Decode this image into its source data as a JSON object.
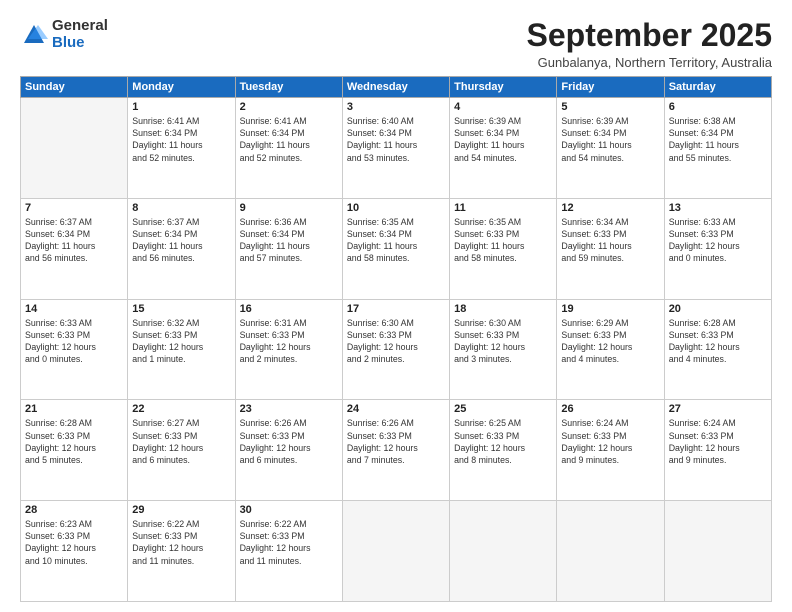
{
  "logo": {
    "general": "General",
    "blue": "Blue"
  },
  "title": "September 2025",
  "subtitle": "Gunbalanya, Northern Territory, Australia",
  "days_header": [
    "Sunday",
    "Monday",
    "Tuesday",
    "Wednesday",
    "Thursday",
    "Friday",
    "Saturday"
  ],
  "weeks": [
    [
      {
        "num": "",
        "info": ""
      },
      {
        "num": "1",
        "info": "Sunrise: 6:41 AM\nSunset: 6:34 PM\nDaylight: 11 hours\nand 52 minutes."
      },
      {
        "num": "2",
        "info": "Sunrise: 6:41 AM\nSunset: 6:34 PM\nDaylight: 11 hours\nand 52 minutes."
      },
      {
        "num": "3",
        "info": "Sunrise: 6:40 AM\nSunset: 6:34 PM\nDaylight: 11 hours\nand 53 minutes."
      },
      {
        "num": "4",
        "info": "Sunrise: 6:39 AM\nSunset: 6:34 PM\nDaylight: 11 hours\nand 54 minutes."
      },
      {
        "num": "5",
        "info": "Sunrise: 6:39 AM\nSunset: 6:34 PM\nDaylight: 11 hours\nand 54 minutes."
      },
      {
        "num": "6",
        "info": "Sunrise: 6:38 AM\nSunset: 6:34 PM\nDaylight: 11 hours\nand 55 minutes."
      }
    ],
    [
      {
        "num": "7",
        "info": "Sunrise: 6:37 AM\nSunset: 6:34 PM\nDaylight: 11 hours\nand 56 minutes."
      },
      {
        "num": "8",
        "info": "Sunrise: 6:37 AM\nSunset: 6:34 PM\nDaylight: 11 hours\nand 56 minutes."
      },
      {
        "num": "9",
        "info": "Sunrise: 6:36 AM\nSunset: 6:34 PM\nDaylight: 11 hours\nand 57 minutes."
      },
      {
        "num": "10",
        "info": "Sunrise: 6:35 AM\nSunset: 6:34 PM\nDaylight: 11 hours\nand 58 minutes."
      },
      {
        "num": "11",
        "info": "Sunrise: 6:35 AM\nSunset: 6:33 PM\nDaylight: 11 hours\nand 58 minutes."
      },
      {
        "num": "12",
        "info": "Sunrise: 6:34 AM\nSunset: 6:33 PM\nDaylight: 11 hours\nand 59 minutes."
      },
      {
        "num": "13",
        "info": "Sunrise: 6:33 AM\nSunset: 6:33 PM\nDaylight: 12 hours\nand 0 minutes."
      }
    ],
    [
      {
        "num": "14",
        "info": "Sunrise: 6:33 AM\nSunset: 6:33 PM\nDaylight: 12 hours\nand 0 minutes."
      },
      {
        "num": "15",
        "info": "Sunrise: 6:32 AM\nSunset: 6:33 PM\nDaylight: 12 hours\nand 1 minute."
      },
      {
        "num": "16",
        "info": "Sunrise: 6:31 AM\nSunset: 6:33 PM\nDaylight: 12 hours\nand 2 minutes."
      },
      {
        "num": "17",
        "info": "Sunrise: 6:30 AM\nSunset: 6:33 PM\nDaylight: 12 hours\nand 2 minutes."
      },
      {
        "num": "18",
        "info": "Sunrise: 6:30 AM\nSunset: 6:33 PM\nDaylight: 12 hours\nand 3 minutes."
      },
      {
        "num": "19",
        "info": "Sunrise: 6:29 AM\nSunset: 6:33 PM\nDaylight: 12 hours\nand 4 minutes."
      },
      {
        "num": "20",
        "info": "Sunrise: 6:28 AM\nSunset: 6:33 PM\nDaylight: 12 hours\nand 4 minutes."
      }
    ],
    [
      {
        "num": "21",
        "info": "Sunrise: 6:28 AM\nSunset: 6:33 PM\nDaylight: 12 hours\nand 5 minutes."
      },
      {
        "num": "22",
        "info": "Sunrise: 6:27 AM\nSunset: 6:33 PM\nDaylight: 12 hours\nand 6 minutes."
      },
      {
        "num": "23",
        "info": "Sunrise: 6:26 AM\nSunset: 6:33 PM\nDaylight: 12 hours\nand 6 minutes."
      },
      {
        "num": "24",
        "info": "Sunrise: 6:26 AM\nSunset: 6:33 PM\nDaylight: 12 hours\nand 7 minutes."
      },
      {
        "num": "25",
        "info": "Sunrise: 6:25 AM\nSunset: 6:33 PM\nDaylight: 12 hours\nand 8 minutes."
      },
      {
        "num": "26",
        "info": "Sunrise: 6:24 AM\nSunset: 6:33 PM\nDaylight: 12 hours\nand 9 minutes."
      },
      {
        "num": "27",
        "info": "Sunrise: 6:24 AM\nSunset: 6:33 PM\nDaylight: 12 hours\nand 9 minutes."
      }
    ],
    [
      {
        "num": "28",
        "info": "Sunrise: 6:23 AM\nSunset: 6:33 PM\nDaylight: 12 hours\nand 10 minutes."
      },
      {
        "num": "29",
        "info": "Sunrise: 6:22 AM\nSunset: 6:33 PM\nDaylight: 12 hours\nand 11 minutes."
      },
      {
        "num": "30",
        "info": "Sunrise: 6:22 AM\nSunset: 6:33 PM\nDaylight: 12 hours\nand 11 minutes."
      },
      {
        "num": "",
        "info": ""
      },
      {
        "num": "",
        "info": ""
      },
      {
        "num": "",
        "info": ""
      },
      {
        "num": "",
        "info": ""
      }
    ]
  ]
}
